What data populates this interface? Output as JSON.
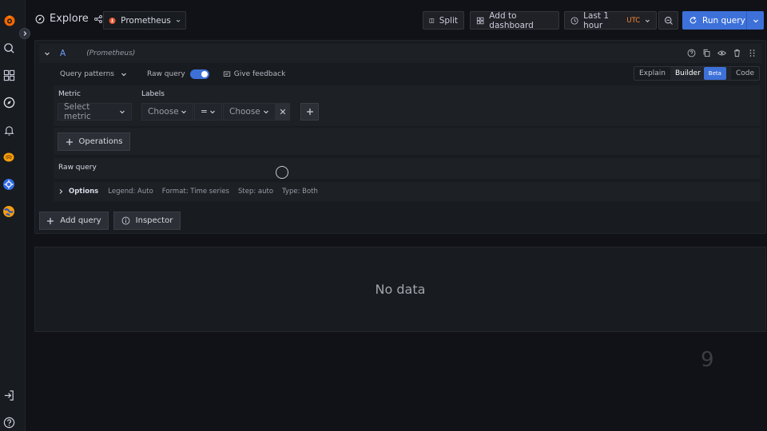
{
  "header": {
    "title": "Explore",
    "datasource": "Prometheus",
    "split_label": "Split",
    "add_to_dashboard_label": "Add to dashboard",
    "time_range": "Last 1 hour",
    "timezone": "UTC",
    "run_query_label": "Run query"
  },
  "query": {
    "ref_id": "A",
    "datasource_name": "(Prometheus)",
    "query_patterns_label": "Query patterns",
    "raw_query_label": "Raw query",
    "give_feedback_label": "Give feedback",
    "modes": [
      "Explain",
      "Builder",
      "Code"
    ],
    "beta_label": "Beta",
    "metric_label": "Metric",
    "metric_placeholder": "Select metric",
    "labels_label": "Labels",
    "label_placeholder": "Choose",
    "operator": "=",
    "value_placeholder": "Choose",
    "remove_symbol": "✕",
    "operations_label": "Operations",
    "raw_query_title": "Raw query",
    "options": {
      "title": "Options",
      "legend": "Legend: Auto",
      "format": "Format: Time series",
      "step": "Step: auto",
      "type": "Type: Both"
    },
    "add_query_label": "Add query",
    "inspector_label": "Inspector"
  },
  "results": {
    "no_data": "No data"
  },
  "overlay_number": "9",
  "colors": {
    "accent": "#3d71d9",
    "timezone": "#ff8833",
    "datasource_icon": "#e6522c"
  }
}
